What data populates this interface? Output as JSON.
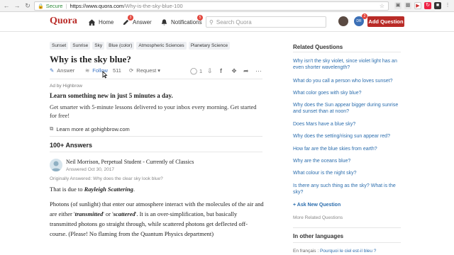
{
  "browser": {
    "secure_label": "Secure",
    "url_domain": "https://www.quora.com",
    "url_path": "/Why-is-the-sky-blue-100"
  },
  "header": {
    "logo": "Quora",
    "nav": [
      {
        "label": "Home",
        "icon": "home-icon",
        "badge": ""
      },
      {
        "label": "Answer",
        "icon": "pencil-icon",
        "badge": "3"
      },
      {
        "label": "Notifications",
        "icon": "bell-icon",
        "badge": "5"
      }
    ],
    "search_placeholder": "Search Quora",
    "avatar2_label": "DR",
    "avatar2_badge": "2",
    "add_question": "Add Question"
  },
  "question": {
    "tags": [
      "Sunset",
      "Sunrise",
      "Sky",
      "Blue (color)",
      "Atmospheric Sciences",
      "Planetary Science"
    ],
    "title": "Why is the sky blue?",
    "answer_label": "Answer",
    "follow_label": "Follow",
    "follow_count": "511",
    "request_label": "Request",
    "comment_count": "1"
  },
  "ad": {
    "label": "Ad by Highbrow",
    "headline": "Learn something new in just 5 minutes a day.",
    "body": "Get smarter with 5-minute lessons delivered to your inbox every morning. Get started for free!",
    "link": "Learn more at gohighbrow.com"
  },
  "answers": {
    "count_label": "100+ Answers",
    "first": {
      "author": "Neil Morrison, Perpetual Student - Currently of Classics",
      "date": "Answered Oct 30, 2017",
      "originally": "Originally Answered: Why does the clear sky look blue?",
      "intro": "That is due to ",
      "intro_em": "Rayleigh Scattering",
      "intro_end": ".",
      "p2_a": "Photons (of sunlight) that enter our atmosphere interact with the molecules of the air and are either '",
      "p2_b": "transmitted",
      "p2_c": "' or '",
      "p2_d": "scattered",
      "p2_e": "'. It is an over-simplification, but basically transmitted photons go straight through, while scattered photons get deflected off-course. (Please! No flaming from the Quantum Physics department)"
    }
  },
  "sidebar": {
    "related_title": "Related Questions",
    "related": [
      "Why isn't the sky violet, since violet light has an even shorter wavelength?",
      "What do you call a person who loves sunset?",
      "What color goes with sky blue?",
      "Why does the Sun appear bigger during sunrise and sunset than at noon?",
      "Does Mars have a blue sky?",
      "Why does the setting/rising sun appear red?",
      "How far are the blue skies from earth?",
      "Why are the oceans blue?",
      "What colour is the night sky?",
      "Is there any such thing as the sky? What is the sky?"
    ],
    "ask_new": "+ Ask New Question",
    "more_related": "More Related Questions",
    "languages_title": "In other languages",
    "lang_prefix": "En français : ",
    "lang_link": "Pourquoi le ciel est-il bleu ?"
  }
}
